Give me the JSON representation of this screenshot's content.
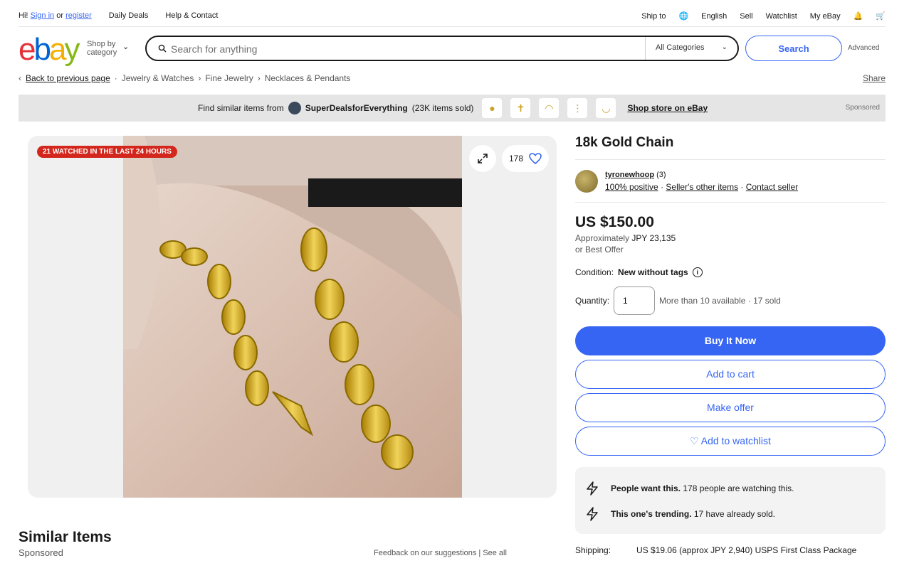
{
  "topbar": {
    "greeting_prefix": "Hi!",
    "sign_in": "Sign in",
    "or": "or",
    "register": "register",
    "daily_deals": "Daily Deals",
    "help": "Help & Contact",
    "ship_to": "Ship to",
    "language": "English",
    "sell": "Sell",
    "watchlist": "Watchlist",
    "my_ebay": "My eBay"
  },
  "header": {
    "logo": {
      "e": "e",
      "b": "b",
      "a": "a",
      "y": "y"
    },
    "shop_by_line1": "Shop by",
    "shop_by_line2": "category",
    "search_placeholder": "Search for anything",
    "category_select": "All Categories",
    "search_button": "Search",
    "advanced": "Advanced"
  },
  "breadcrumb": {
    "back": "Back to previous page",
    "items": [
      "Jewelry & Watches",
      "Fine Jewelry",
      "Necklaces & Pendants"
    ],
    "share": "Share"
  },
  "banner": {
    "find_similar": "Find similar items from",
    "store_name": "SuperDealsforEverything",
    "items_sold": "(23K items sold)",
    "shop_store": "Shop store on eBay",
    "sponsored": "Sponsored"
  },
  "gallery": {
    "watched_badge": "21 WATCHED IN THE LAST 24 HOURS",
    "watch_count": "178"
  },
  "item": {
    "title": "18k Gold Chain",
    "seller_name": "tyronewhoop",
    "seller_score": "(3)",
    "positive": "100% positive",
    "other_items": "Seller's other items",
    "contact": "Contact seller",
    "price": "US $150.00",
    "approx_prefix": "Approximately",
    "approx_value": "JPY 23,135",
    "best_offer": "or Best Offer",
    "condition_label": "Condition:",
    "condition_value": "New without tags",
    "quantity_label": "Quantity:",
    "quantity_value": "1",
    "availability": "More than 10 available · 17 sold",
    "buy_now": "Buy It Now",
    "add_to_cart": "Add to cart",
    "make_offer": "Make offer",
    "add_watchlist": "♡ Add to watchlist"
  },
  "urgency": {
    "row1_bold": "People want this.",
    "row1_text": "178 people are watching this.",
    "row2_bold": "This one's trending.",
    "row2_text": "17 have already sold."
  },
  "shipping": {
    "label": "Shipping:",
    "value": "US $19.06 (approx JPY 2,940) USPS First Class Package"
  },
  "similar": {
    "title": "Similar Items",
    "sponsored": "Sponsored",
    "feedback": "Feedback on our suggestions  |  See all"
  },
  "colors": {
    "primary": "#3665f3",
    "badge_red": "#d3271d",
    "banner_bg": "#e5e5e5"
  }
}
